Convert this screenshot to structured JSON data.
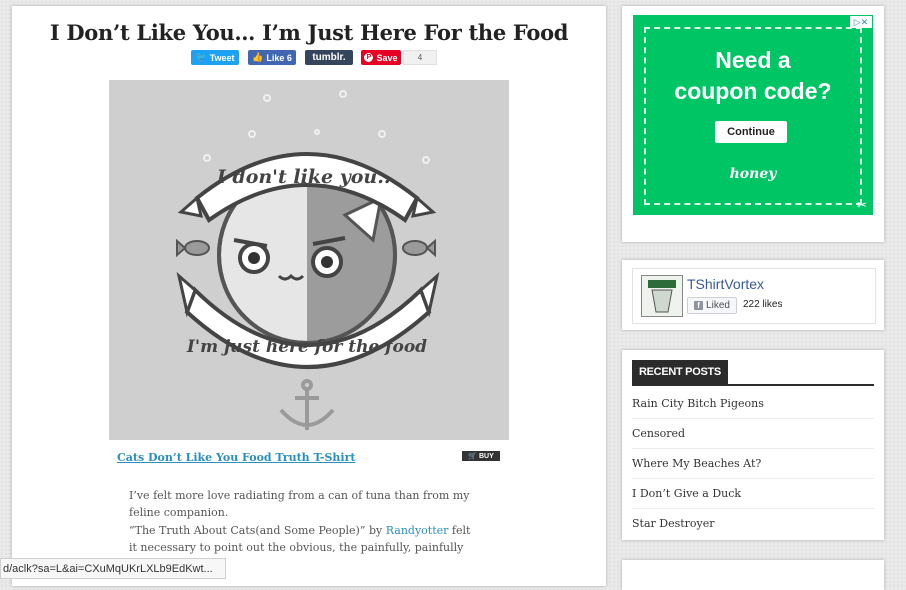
{
  "post": {
    "title": "I Don’t Like You… I’m Just Here For the Food",
    "share": {
      "tweet": "Tweet",
      "like": "Like 6",
      "tumblr": "tumblr.",
      "save": "Save",
      "pin_count": "4"
    },
    "artwork": {
      "top_text": "I don't like you...",
      "bottom_text": "I'm just here for the food"
    },
    "product_link": "Cats Don’t Like You Food Truth T-Shirt",
    "buy_label": "BUY",
    "paragraph1": "I’ve felt more love radiating from a can of tuna than from my feline companion.",
    "paragraph2_before": "“The Truth About Cats(and Some People)” by ",
    "paragraph2_link": "Randyotter",
    "paragraph2_after": " felt it necessary to point out the obvious, the painfully, painfully obvious."
  },
  "ad": {
    "headline_line1": "Need a",
    "headline_line2": "coupon code?",
    "button": "Continue",
    "brand": "honey",
    "adchoices": "▷✕",
    "accent": "#00c564"
  },
  "facebook": {
    "page_name": "TShirtVortex",
    "liked_label": "Liked",
    "likes": "222 likes"
  },
  "recent_posts": {
    "heading": "RECENT POSTS",
    "items": [
      "Rain City Bitch Pigeons",
      "Censored",
      "Where My Beaches At?",
      "I Don’t Give a Duck",
      "Star Destroyer"
    ]
  },
  "status_url": "d/aclk?sa=L&ai=CXuMqUKrLXLb9EdKwt..."
}
